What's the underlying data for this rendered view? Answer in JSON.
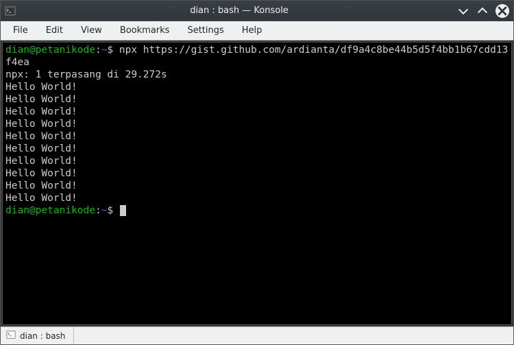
{
  "titlebar": {
    "title": "dian : bash — Konsole"
  },
  "menubar": {
    "items": [
      "File",
      "Edit",
      "View",
      "Bookmarks",
      "Settings",
      "Help"
    ]
  },
  "terminal": {
    "user_host": "dian@petanikode",
    "colon": ":",
    "cwd": "~",
    "prompt_symbol": "$",
    "command": "npx https://gist.github.com/ardianta/df9a4c8be44b5d5f4bb1b67cdd13f4ea",
    "install_line": "npx: 1 terpasang di 29.272s",
    "output_lines": [
      "Hello World!",
      "Hello World!",
      "Hello World!",
      "Hello World!",
      "Hello World!",
      "Hello World!",
      "Hello World!",
      "Hello World!",
      "Hello World!",
      "Hello World!"
    ]
  },
  "tabbar": {
    "tab_label": "dian : bash"
  }
}
